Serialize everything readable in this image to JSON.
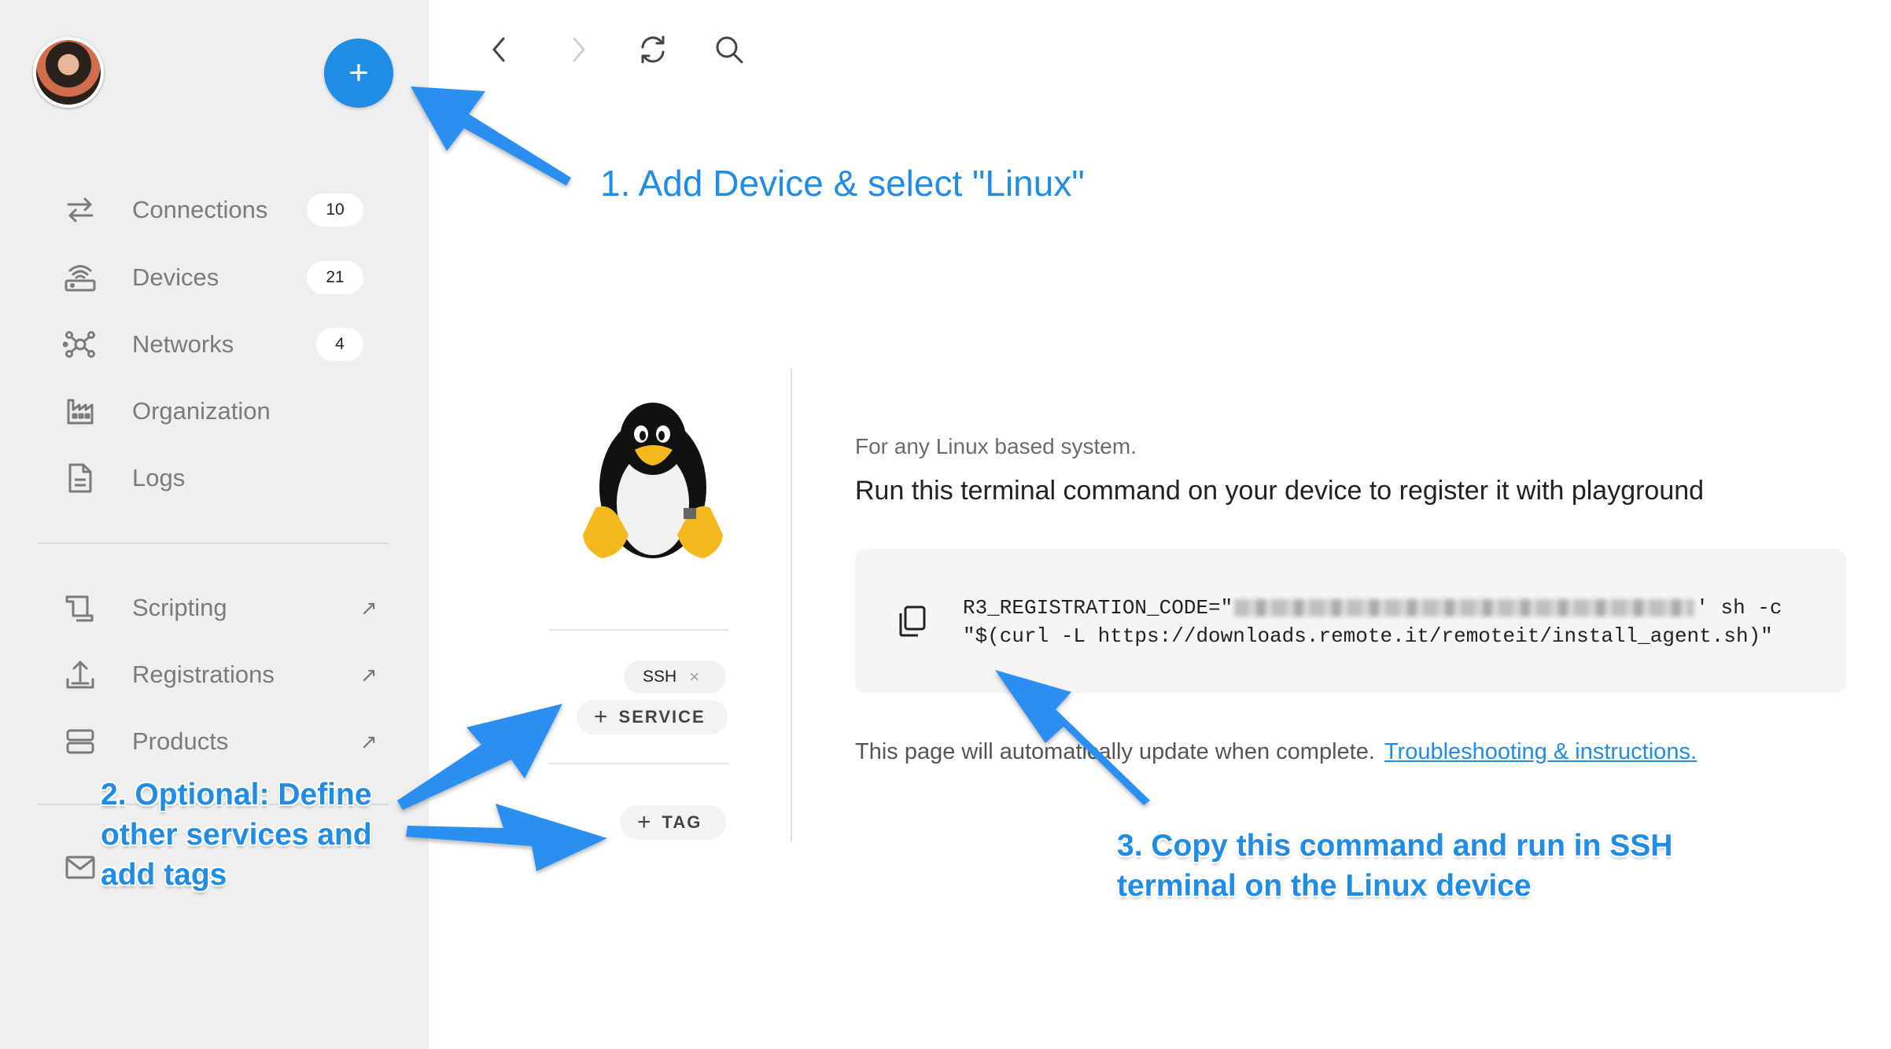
{
  "sidebar": {
    "add_button_label": "+",
    "nav": [
      {
        "label": "Connections",
        "badge": "10",
        "icon": "connections-icon"
      },
      {
        "label": "Devices",
        "badge": "21",
        "icon": "devices-icon"
      },
      {
        "label": "Networks",
        "badge": "4",
        "icon": "networks-icon"
      },
      {
        "label": "Organization",
        "icon": "organization-icon"
      },
      {
        "label": "Logs",
        "icon": "logs-icon"
      }
    ],
    "external": [
      {
        "label": "Scripting",
        "icon": "scripting-icon",
        "ext": "↗"
      },
      {
        "label": "Registrations",
        "icon": "registrations-icon",
        "ext": "↗"
      },
      {
        "label": "Products",
        "icon": "products-icon",
        "ext": "↗"
      }
    ]
  },
  "toolbar": {
    "icons": [
      "back-icon",
      "forward-icon",
      "refresh-icon",
      "search-icon"
    ]
  },
  "device": {
    "services": [
      {
        "label": "SSH",
        "remove": "×"
      }
    ],
    "add_service_label": "SERVICE",
    "add_tag_label": "TAG",
    "plus": "+"
  },
  "content": {
    "subtitle": "For any Linux based system.",
    "instruction": "Run this terminal command on your device to register it with playground",
    "command_prefix": "R3_REGISTRATION_CODE=\"",
    "command_suffix": "' sh -c",
    "command_line2": "\"$(curl -L https://downloads.remote.it/remoteit/install_agent.sh)\"",
    "note": "This page will automatically update when complete.",
    "help_link": "Troubleshooting & instructions."
  },
  "annotations": {
    "step1": "1. Add Device & select \"Linux\"",
    "step2_lines": [
      "2.  Optional: Define",
      "other services and",
      "add tags"
    ],
    "step3_lines": [
      "3. Copy this command and run in SSH",
      "terminal on the Linux device"
    ],
    "color": "#1f8ce6"
  },
  "colors": {
    "accent": "#1f8ce6",
    "sidebar_bg": "#efefef"
  }
}
